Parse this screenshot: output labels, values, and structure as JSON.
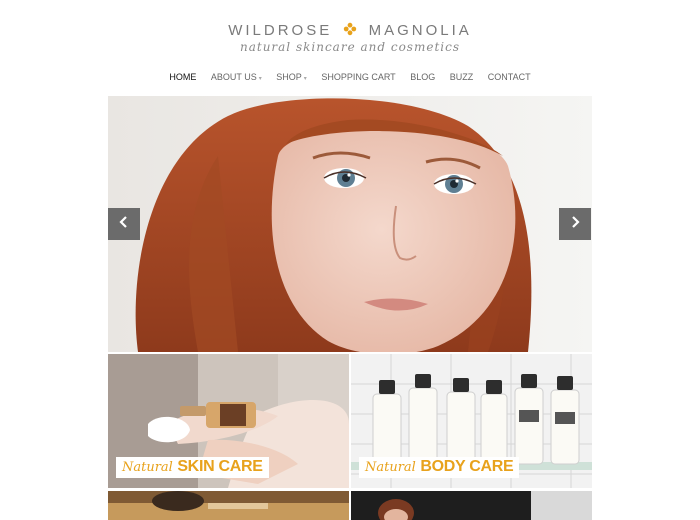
{
  "brand": {
    "left": "WILDROSE",
    "right": "MAGNOLIA",
    "tagline": "natural skincare and cosmetics",
    "accent": "#e8a21c"
  },
  "nav": {
    "items": [
      {
        "label": "HOME"
      },
      {
        "label": "ABOUT US"
      },
      {
        "label": "SHOP"
      },
      {
        "label": "SHOPPING CART"
      },
      {
        "label": "BLOG"
      },
      {
        "label": "BUZZ"
      },
      {
        "label": "CONTACT"
      }
    ]
  },
  "slider": {
    "prev_icon": "chevron-left-icon",
    "next_icon": "chevron-right-icon"
  },
  "tiles": [
    {
      "natural": "Natural",
      "kind": "SKIN CARE"
    },
    {
      "natural": "Natural",
      "kind": "BODY CARE"
    }
  ]
}
